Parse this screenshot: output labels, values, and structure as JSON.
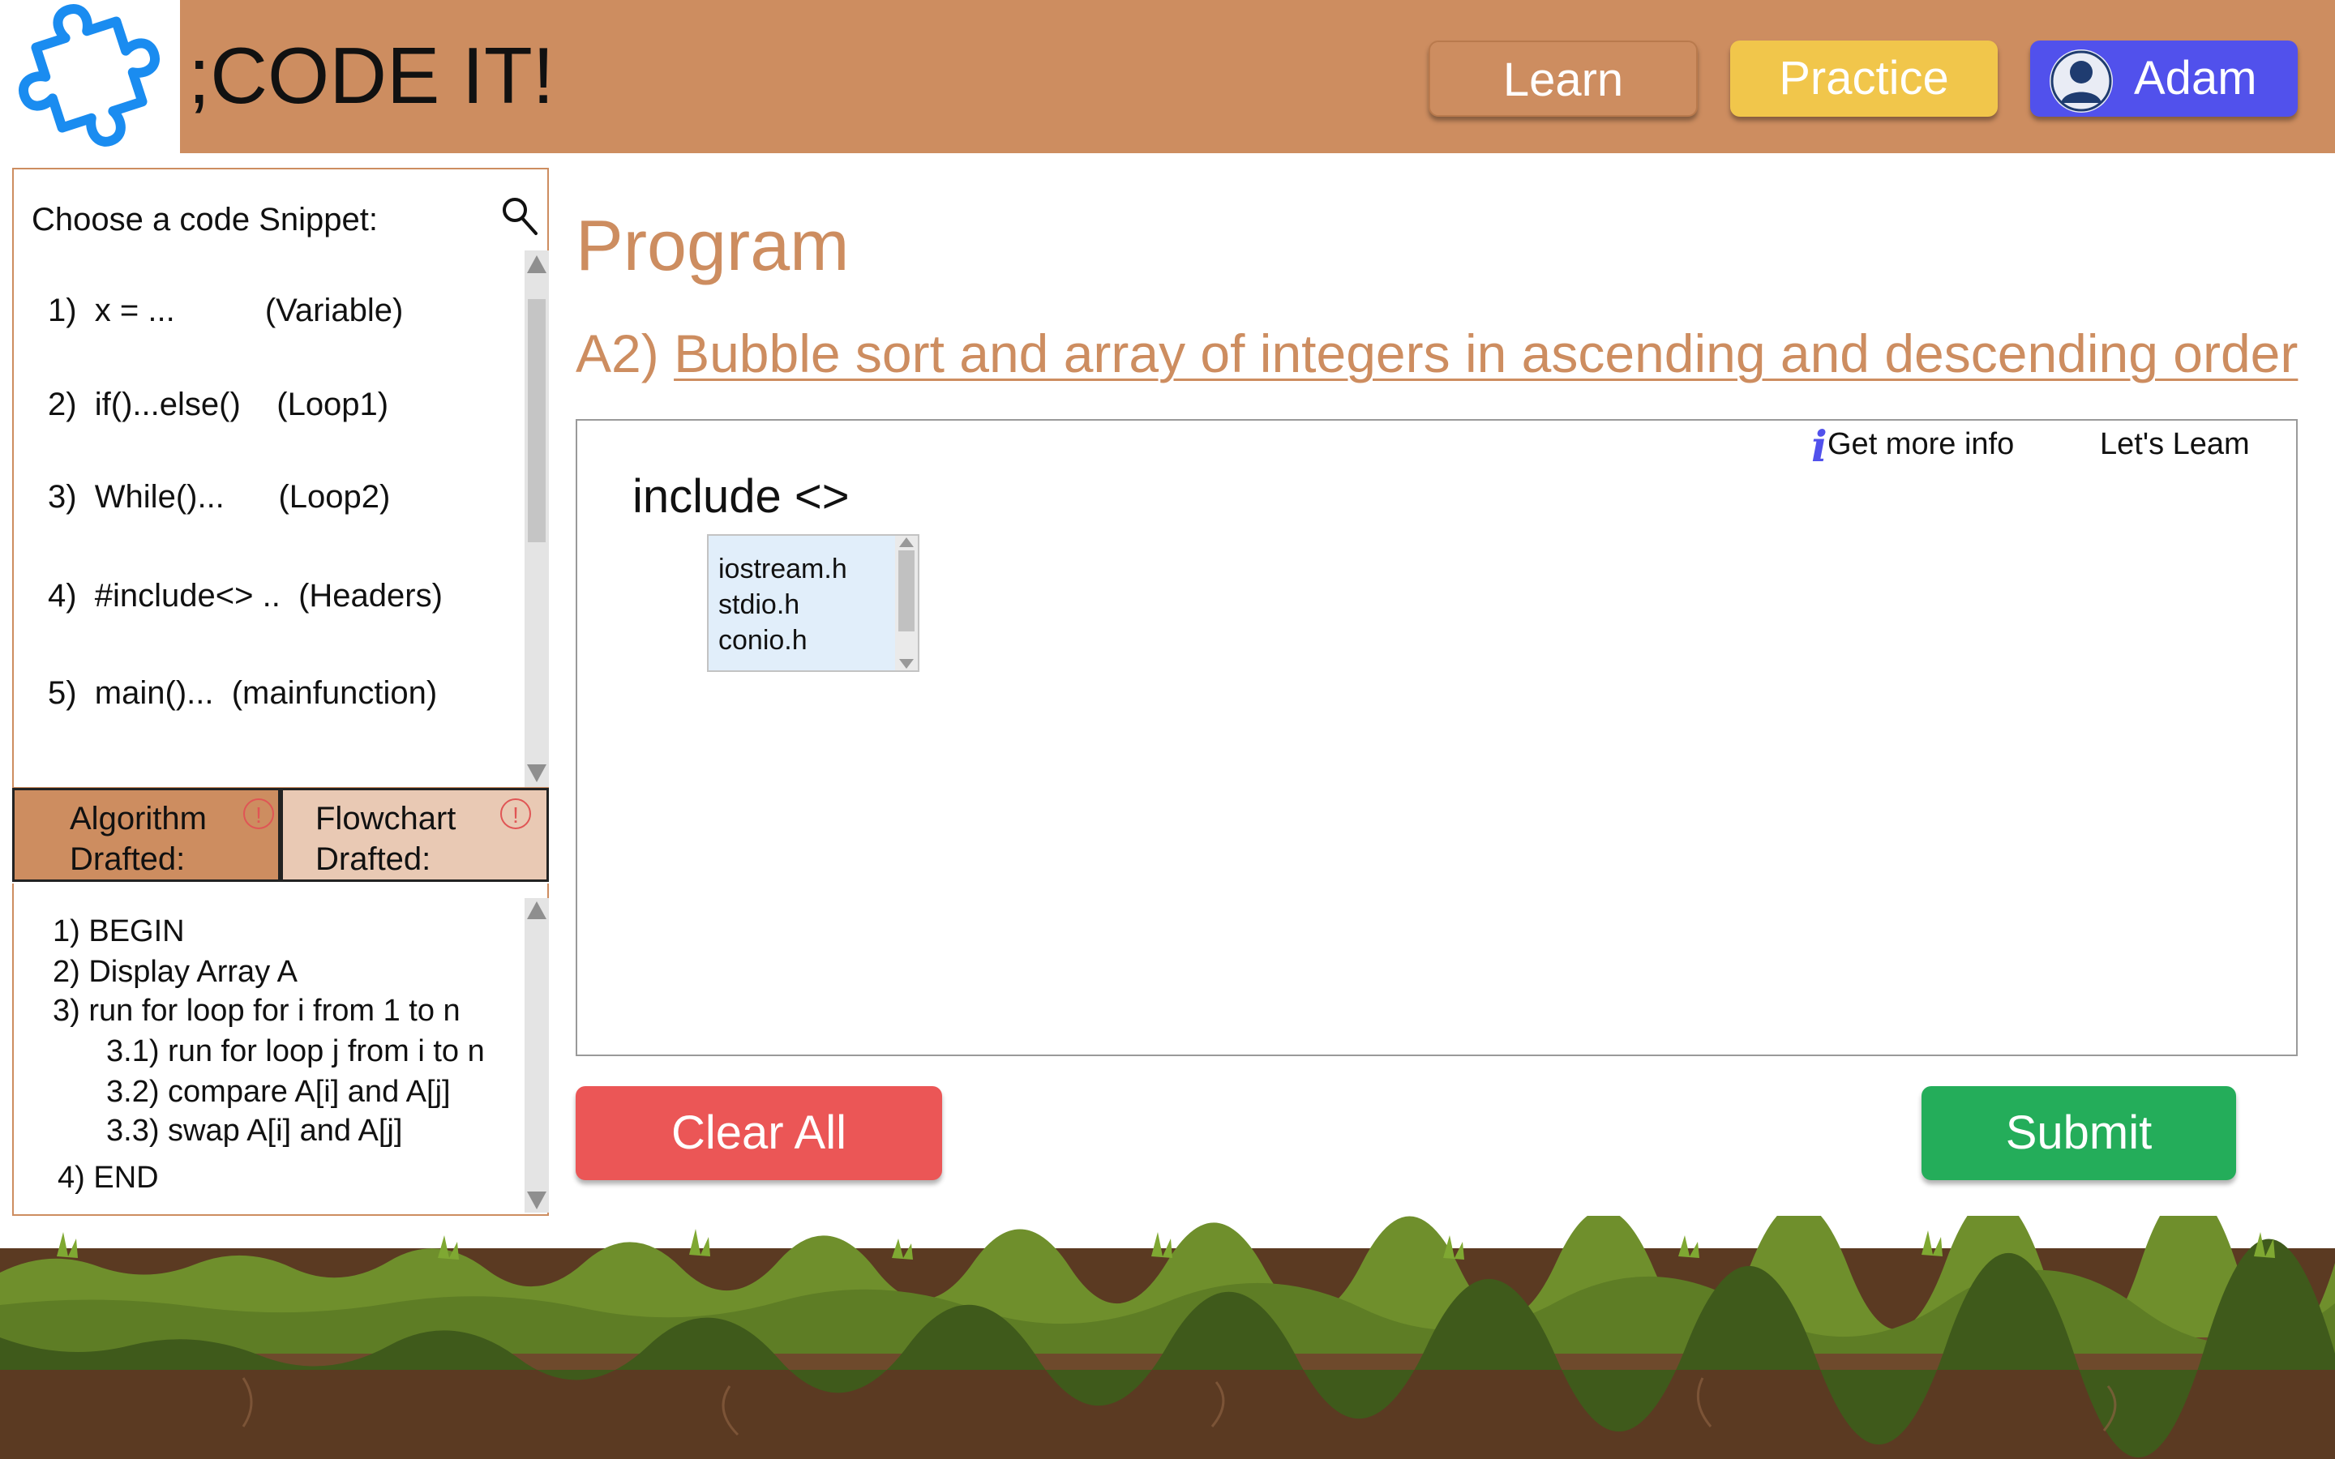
{
  "header": {
    "brand": ";CODE IT!",
    "nav": {
      "learn": "Learn",
      "practice": "Practice",
      "user": "Adam"
    }
  },
  "sidebar": {
    "snippet_title": "Choose a code Snippet:",
    "snippets": [
      "1)  x = ...          (Variable)",
      "2)  if()...else()    (Loop1)",
      "3)  While()...      (Loop2)",
      "4)  #include<> ..  (Headers)",
      "5)  main()...  (mainfunction)"
    ],
    "tabs": {
      "algorithm": "Algorithm\nDrafted:",
      "flowchart": "Flowchart\nDrafted:",
      "alert_symbol": "!"
    },
    "algorithm_steps": [
      "1) BEGIN",
      "2) Display Array A",
      "3) run for loop for i from 1 to n",
      "3.1) run for loop j from i to n",
      "3.2) compare A[i] and A[j]",
      "3.3) swap A[i] and A[j]",
      "4) END"
    ]
  },
  "main": {
    "title": "Program",
    "task_prefix": "A2)",
    "task_text": "Bubble sort and array of integers in ascending and descending order",
    "editor": {
      "info_icon": "i",
      "get_info": "Get more info",
      "lets_learn": "Let's Leam",
      "include_line": "include <>",
      "header_options": [
        "iostream.h",
        "stdio.h",
        "conio.h"
      ]
    },
    "buttons": {
      "clear": "Clear All",
      "submit": "Submit"
    }
  },
  "colors": {
    "header_bg": "#cd8d60",
    "practice_btn": "#f1c64b",
    "user_btn": "#5151ec",
    "clear_btn": "#eb5656",
    "submit_btn": "#24ad5a",
    "accent_text": "#cd8d60",
    "logo_blue": "#1a8cf0"
  },
  "icons": {
    "logo": "puzzle-piece-icon",
    "search": "search-icon",
    "user": "user-avatar-icon",
    "alert": "alert-circle-icon",
    "info": "info-icon"
  }
}
